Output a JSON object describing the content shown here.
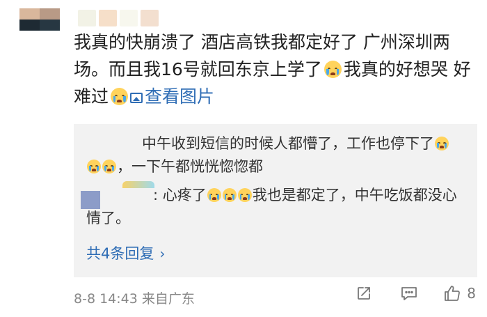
{
  "comment": {
    "text_part1": "我真的快崩溃了 酒店高铁我都定好了 广州深圳两场。而且我16号就回东京上学了",
    "text_part2": "我真的好想哭 好难过",
    "view_pic_label": "查看图片"
  },
  "replies": {
    "items": [
      {
        "text_a": "中午收到短信的时候人都懵了，工作也停下了",
        "text_b": "，一下午都恍恍惚惚都"
      },
      {
        "prefix": ":",
        "text_a": "心疼了",
        "text_b": "我也是都定了，中午吃饭都没心情了。"
      }
    ],
    "more_label": "共4条回复",
    "more_chevron": "›"
  },
  "meta": {
    "timestamp": "8-8 14:43",
    "source": "来自广东"
  },
  "actions": {
    "like_count": "8"
  },
  "icons": {
    "share": "share-icon",
    "comment": "comment-icon",
    "like": "thumbs-up-icon",
    "emoji": "crying-face-emoji",
    "image": "image-icon"
  },
  "colors": {
    "link": "#2f6db5",
    "reply_bg": "#f2f2f2",
    "meta_gray": "#888888"
  }
}
